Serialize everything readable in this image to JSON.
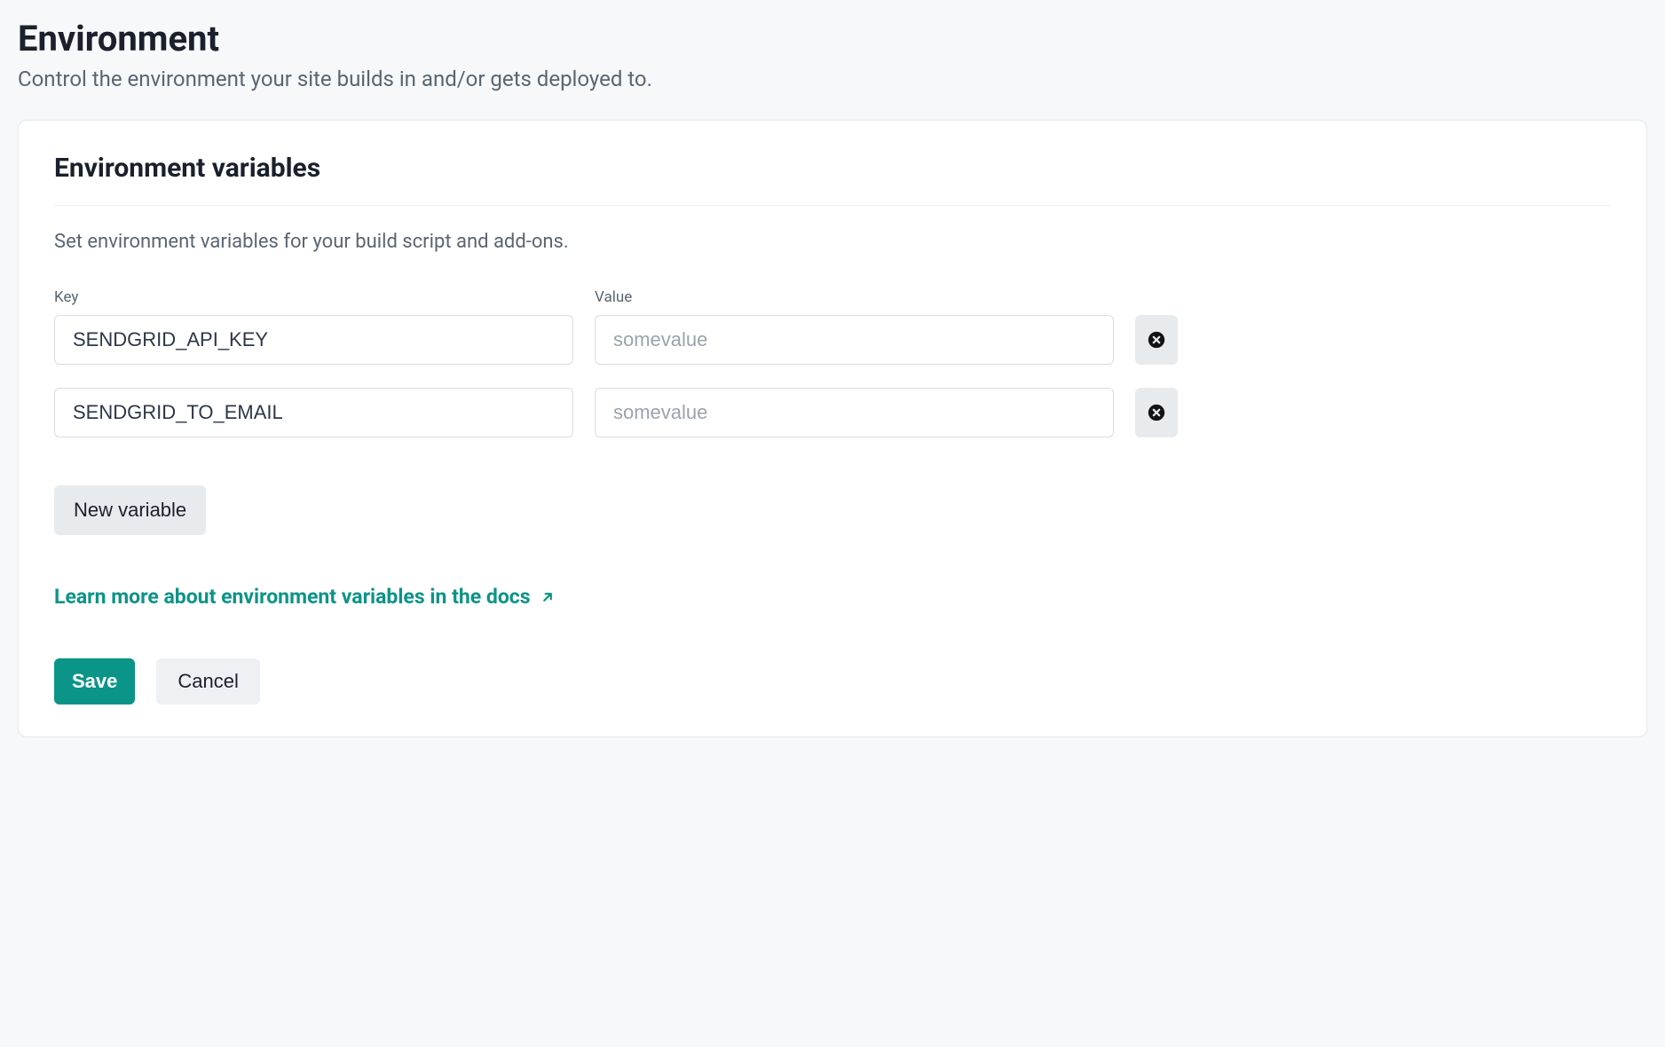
{
  "header": {
    "title": "Environment",
    "subtitle": "Control the environment your site builds in and/or gets deployed to."
  },
  "panel": {
    "title": "Environment variables",
    "description": "Set environment variables for your build script and add-ons.",
    "key_label": "Key",
    "value_label": "Value",
    "variables": [
      {
        "key": "SENDGRID_API_KEY",
        "value": "",
        "placeholder": "somevalue"
      },
      {
        "key": "SENDGRID_TO_EMAIL",
        "value": "",
        "placeholder": "somevalue"
      }
    ],
    "new_variable_label": "New variable",
    "learn_more_label": "Learn more about environment variables in the docs",
    "save_label": "Save",
    "cancel_label": "Cancel"
  },
  "colors": {
    "accent": "#0b9488",
    "panel_border": "#e5e8eb",
    "muted_bg": "#e8ebee"
  }
}
